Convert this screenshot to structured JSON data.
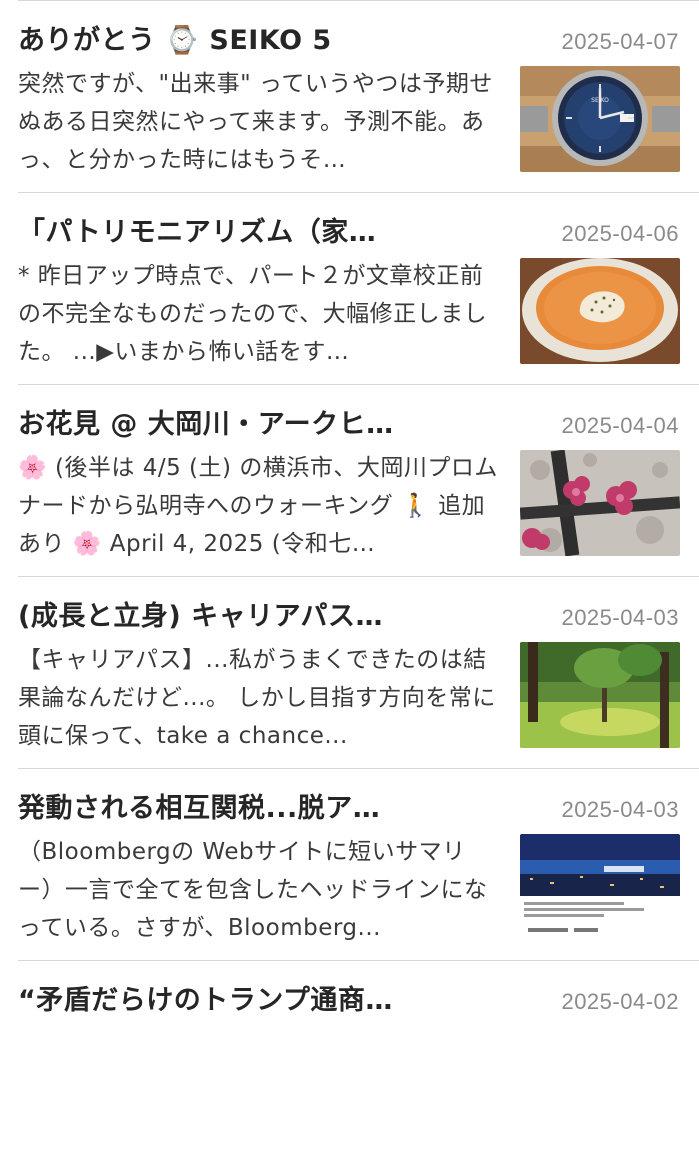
{
  "posts": [
    {
      "title": "ありがとう ⌚ SEIKO 5",
      "date": "2025-04-07",
      "excerpt": "突然ですが、\"出来事\" っていうやつは予期せぬある日突然にやって来ます。予測不能。あっ、と分かった時にはもうそ…",
      "thumb_icon": "seiko-watch-photo"
    },
    {
      "title": "「パトリモニアリズム（家…",
      "date": "2025-04-06",
      "excerpt": "* 昨日アップ時点で、パート２が文章校正前の不完全なものだったので、大幅修正しました。 ...▶いまから怖い話をす…",
      "thumb_icon": "soup-bowl-photo"
    },
    {
      "title": "お花見 @ 大岡川・アークヒ…",
      "date": "2025-04-04",
      "excerpt": "🌸 (後半は 4/5 (土) の横浜市、大岡川プロムナードから弘明寺へのウォーキング 🚶 追加あり 🌸 April 4, 2025 (令和七…",
      "thumb_icon": "cherry-blossom-photo"
    },
    {
      "title": "(成長と立身) キャリアパス…",
      "date": "2025-04-03",
      "excerpt": "【キャリアパス】...私がうまくできたのは結果論なんだけど...。 しかし目指す方向を常に頭に保って、take a chance...",
      "thumb_icon": "park-trees-photo"
    },
    {
      "title": "発動される相互関税...脱ア…",
      "date": "2025-04-03",
      "excerpt": "（Bloombergの Webサイトに短いサマリー）一言で全てを包含したヘッドラインになっている。さすが、Bloomberg...",
      "thumb_icon": "port-city-photo"
    },
    {
      "title": "“矛盾だらけのトランプ通商…",
      "date": "2025-04-02",
      "excerpt": "",
      "thumb_icon": ""
    }
  ]
}
